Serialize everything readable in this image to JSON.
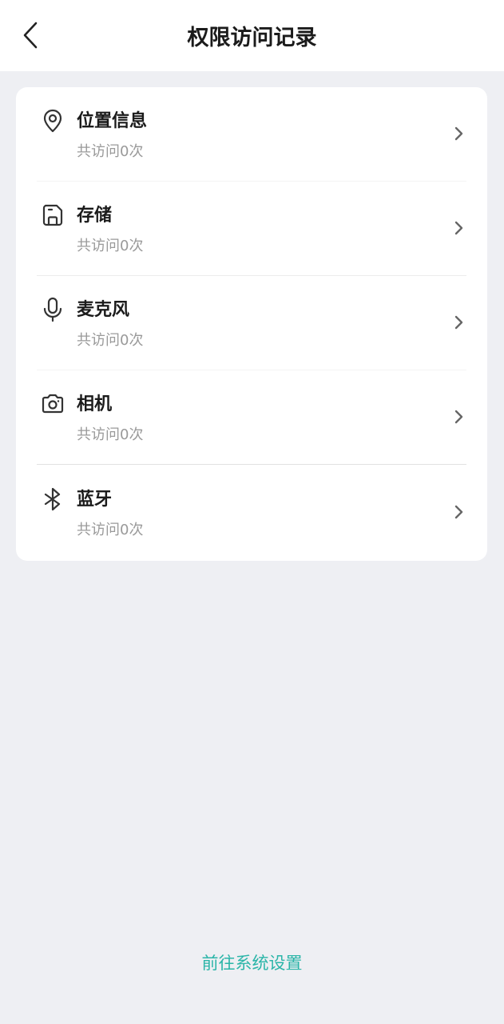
{
  "header": {
    "title": "权限访问记录",
    "back_icon": "chevron-left-icon"
  },
  "permissions": [
    {
      "label": "位置信息",
      "count_text": "共访问0次",
      "icon": "location-pin-icon"
    },
    {
      "label": "存储",
      "count_text": "共访问0次",
      "icon": "storage-icon"
    },
    {
      "label": "麦克风",
      "count_text": "共访问0次",
      "icon": "microphone-icon"
    },
    {
      "label": "相机",
      "count_text": "共访问0次",
      "icon": "camera-icon"
    },
    {
      "label": "蓝牙",
      "count_text": "共访问0次",
      "icon": "bluetooth-icon"
    }
  ],
  "footer": {
    "link_label": "前往系统设置"
  },
  "colors": {
    "background": "#eeeff3",
    "accent": "#2bb5a8",
    "title_text": "#1b1b1b",
    "secondary_text": "#9a9a9a"
  }
}
